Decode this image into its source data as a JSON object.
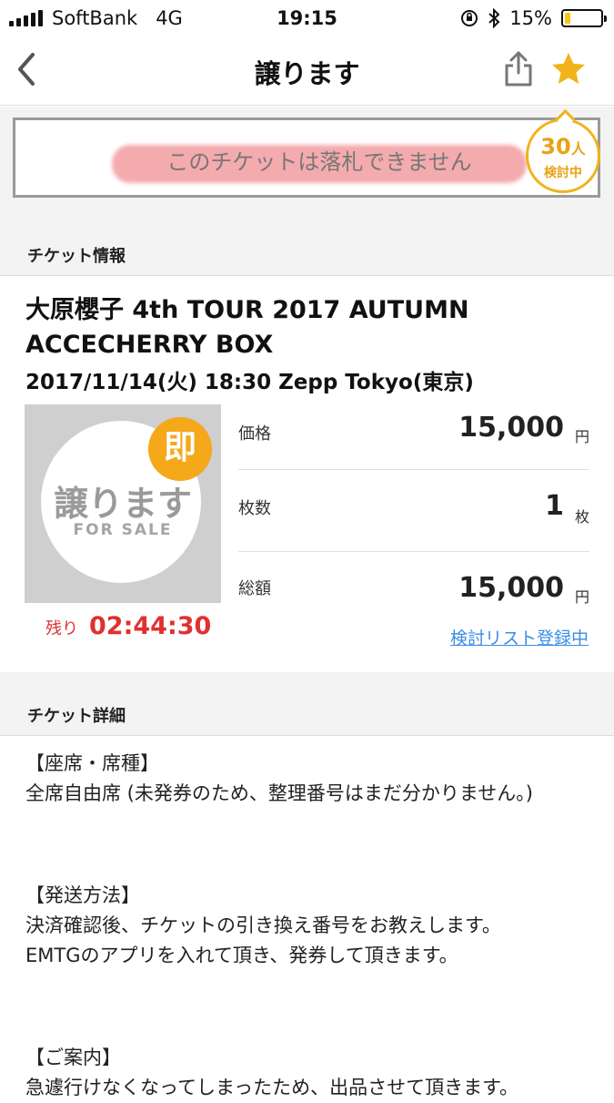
{
  "status_bar": {
    "carrier": "SoftBank",
    "network": "4G",
    "time": "19:15",
    "battery": "15%",
    "battery_level": 0.15
  },
  "nav": {
    "title": "譲ります",
    "back_icon": "chevron-left-icon",
    "share_icon": "share-icon",
    "star_icon": "star-icon"
  },
  "notice": {
    "text": "このチケットは落札できません",
    "watch_count": "30",
    "watch_count_unit": "人",
    "watch_label": "検討中"
  },
  "ticket_info": {
    "section_title": "チケット情報",
    "event_title": "大原櫻子 4th TOUR 2017 AUTUMN ACCECHERRY BOX",
    "event_date": "2017/11/14(火) 18:30 Zepp Tokyo(東京)",
    "thumbnail": {
      "main": "譲ります",
      "sub": "FOR SALE",
      "badge": "即"
    },
    "price": {
      "label": "価格",
      "value": "15,000",
      "unit": "円"
    },
    "quantity": {
      "label": "枚数",
      "value": "1",
      "unit": "枚"
    },
    "total": {
      "label": "総額",
      "value": "15,000",
      "unit": "円"
    },
    "remaining_label": "残り",
    "remaining_time": "02:44:30",
    "watchlist_link": "検討リスト登録中"
  },
  "ticket_details": {
    "section_title": "チケット詳細",
    "seat_heading": "【座席・席種】",
    "seat_text": "全席自由席 (未発券のため、整理番号はまだ分かりません。)",
    "shipping_heading": "【発送方法】",
    "shipping_text_1": "決済確認後、チケットの引き換え番号をお教えします。",
    "shipping_text_2": "EMTGのアプリを入れて頂き、発券して頂きます。",
    "guide_heading": "【ご案内】",
    "guide_text": "急遽行けなくなってしまったため、出品させて頂きます。"
  },
  "colors": {
    "accent_orange": "#f0b31a",
    "countdown_red": "#e03030",
    "link_blue": "#3a8ee6",
    "highlight_pink": "#f3a2a6"
  }
}
